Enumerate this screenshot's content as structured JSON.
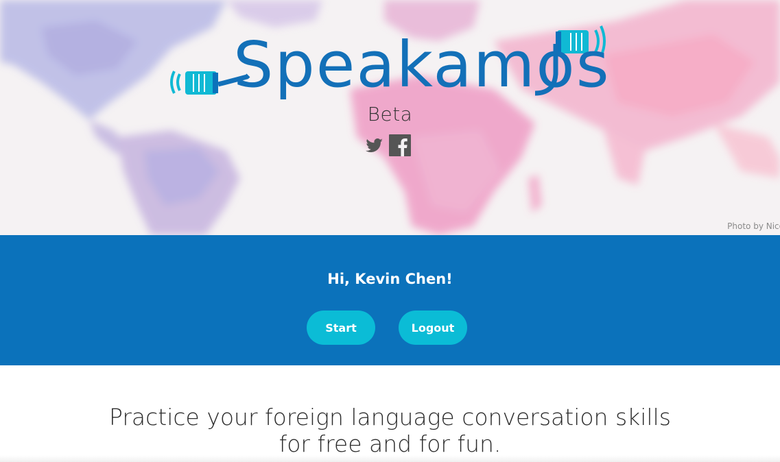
{
  "header": {
    "logo_text": "Speakamos",
    "subtitle": "Beta",
    "social_icons": [
      "twitter-icon",
      "facebook-icon"
    ],
    "photo_credit": "Photo by Nico"
  },
  "welcome": {
    "greeting": "Hi, Kevin Chen!",
    "start_label": "Start",
    "logout_label": "Logout"
  },
  "main": {
    "tagline_line1": "Practice your foreign language conversation skills",
    "tagline_line2": "for free and for fun."
  },
  "colors": {
    "brand_blue": "#0b72bb",
    "accent_cyan": "#0bbcd6",
    "logo_blue": "#1370b8"
  }
}
